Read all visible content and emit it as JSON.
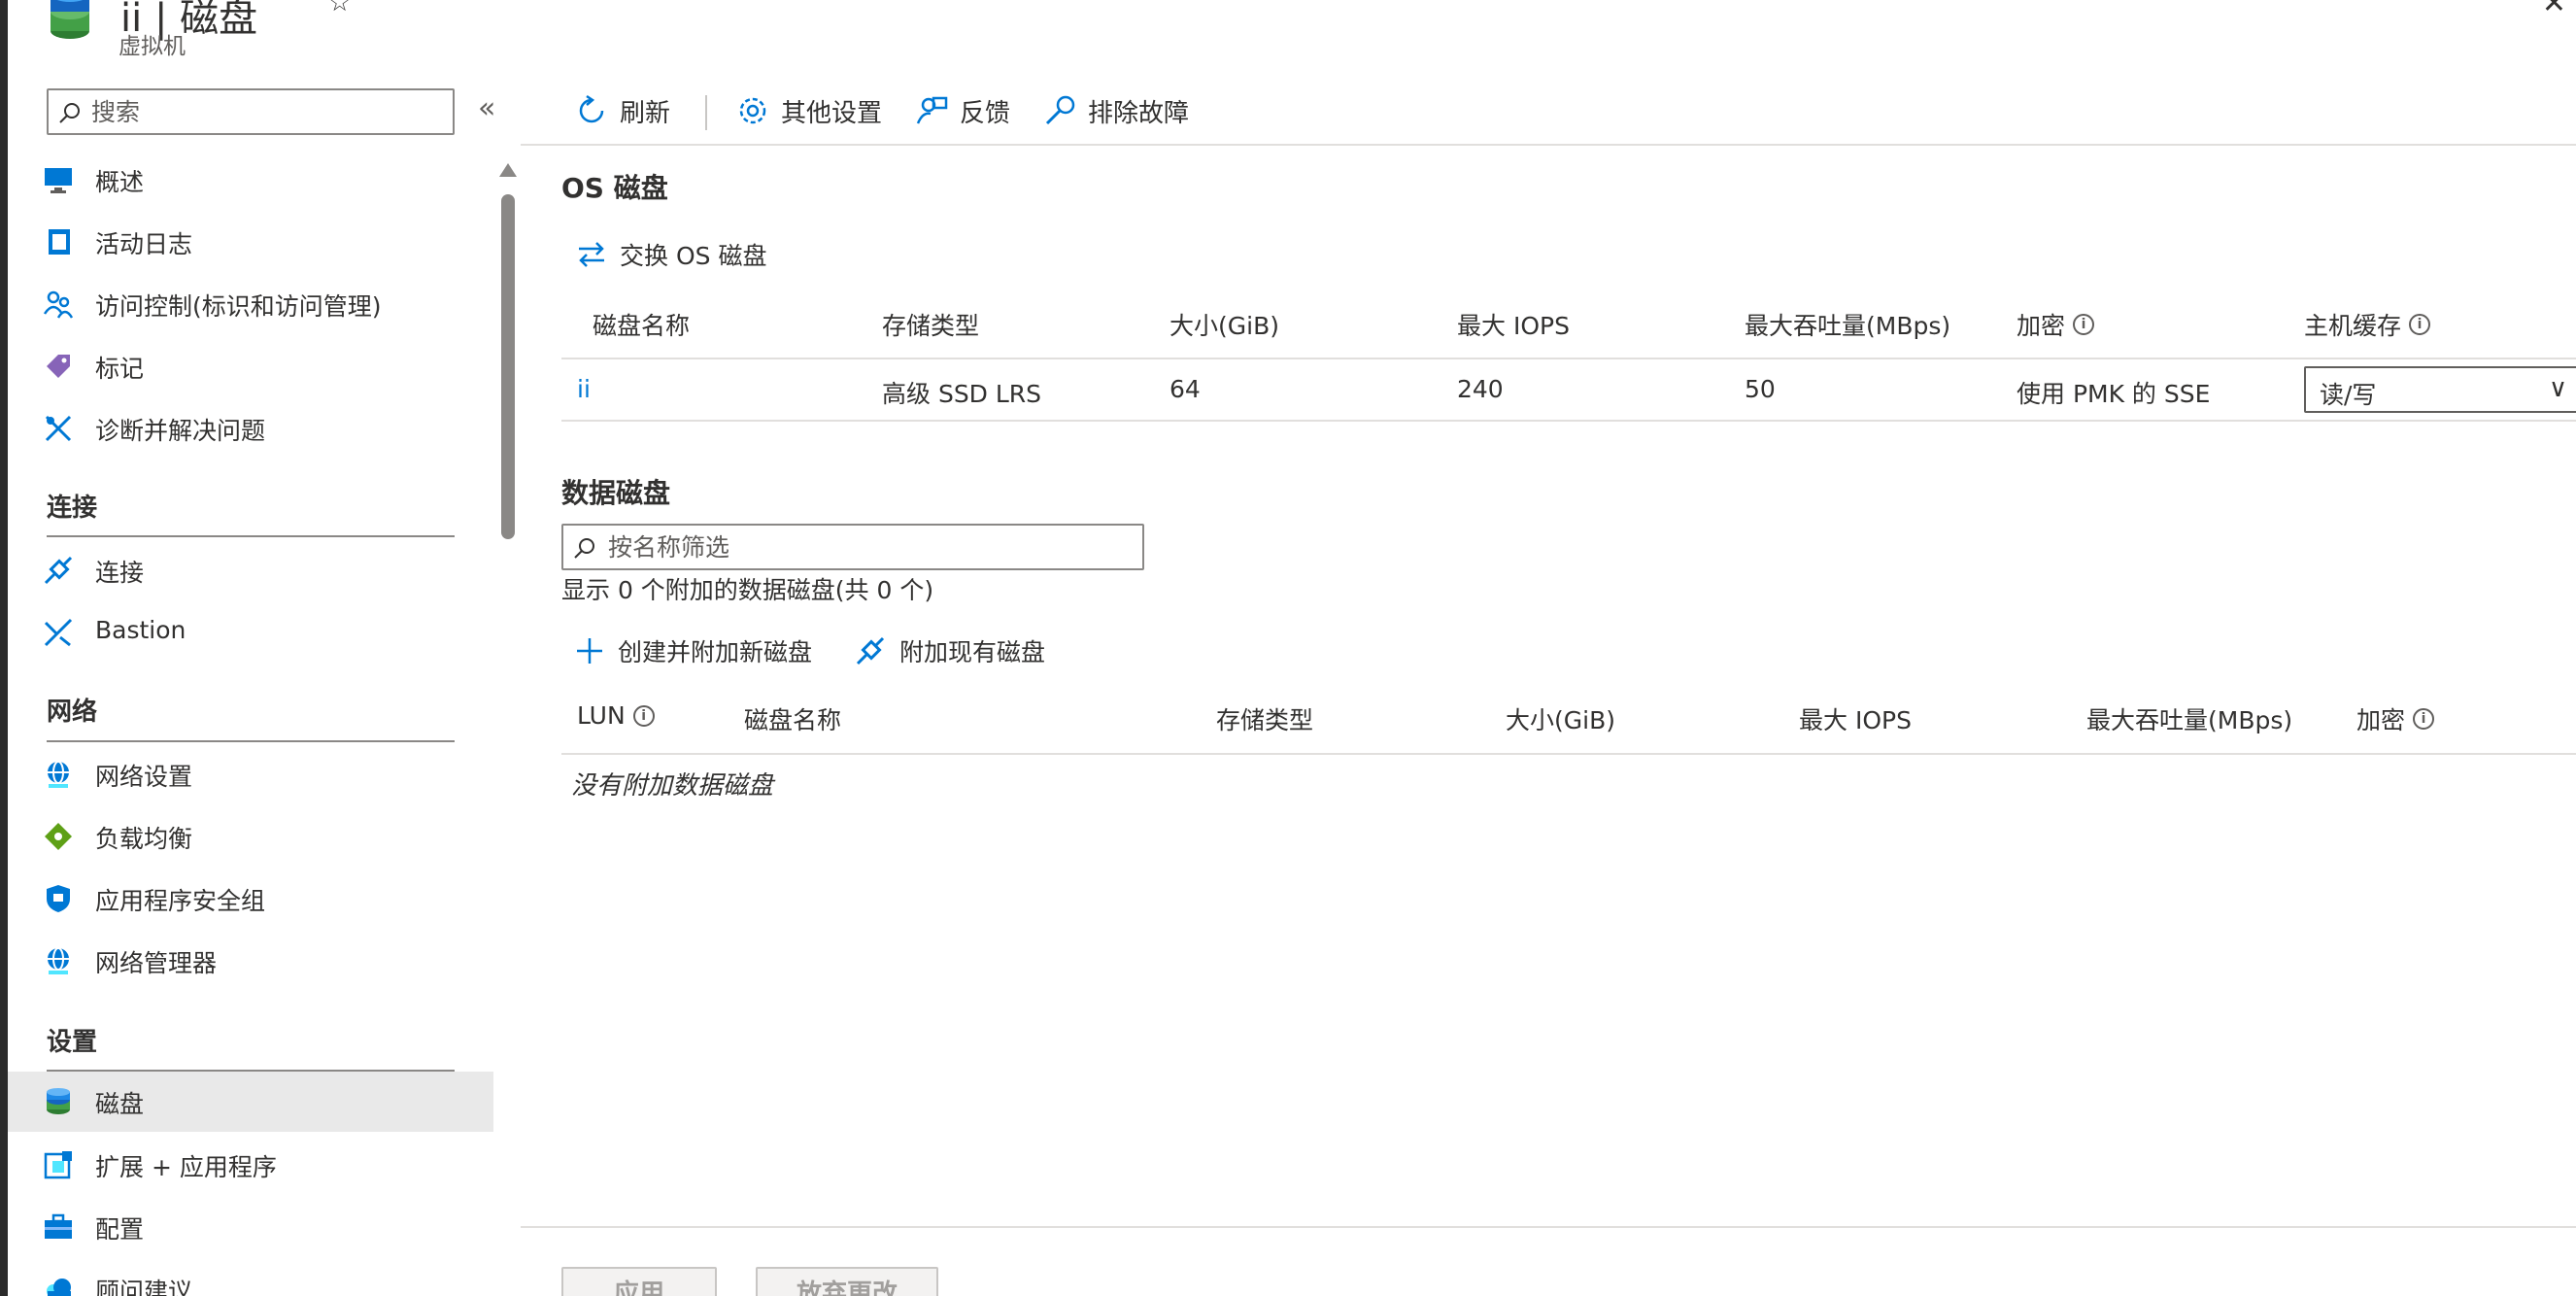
{
  "header": {
    "title": "ii | 磁盘",
    "subtitle": "虚拟机",
    "favorite_icon": "star-icon",
    "close_icon": "close-icon"
  },
  "sidebar": {
    "search_placeholder": "搜索",
    "collapse_glyph": "«",
    "groups": [
      {
        "heading": "",
        "items": [
          {
            "label": "概述",
            "icon": "monitor-icon"
          },
          {
            "label": "活动日志",
            "icon": "log-icon"
          },
          {
            "label": "访问控制(标识和访问管理)",
            "icon": "people-icon"
          },
          {
            "label": "标记",
            "icon": "tag-icon"
          },
          {
            "label": "诊断并解决问题",
            "icon": "wrench-icon"
          }
        ]
      },
      {
        "heading": "连接",
        "items": [
          {
            "label": "连接",
            "icon": "plug-icon"
          },
          {
            "label": "Bastion",
            "icon": "bastion-icon"
          }
        ]
      },
      {
        "heading": "网络",
        "items": [
          {
            "label": "网络设置",
            "icon": "globe-icon"
          },
          {
            "label": "负载均衡",
            "icon": "diamond-icon"
          },
          {
            "label": "应用程序安全组",
            "icon": "shield-icon"
          },
          {
            "label": "网络管理器",
            "icon": "network-manager-icon"
          }
        ]
      },
      {
        "heading": "设置",
        "items": [
          {
            "label": "磁盘",
            "icon": "disk-icon",
            "selected": true
          },
          {
            "label": "扩展 + 应用程序",
            "icon": "extension-icon"
          },
          {
            "label": "配置",
            "icon": "toolbox-icon"
          },
          {
            "label": "顾问建议",
            "icon": "cloud-icon"
          }
        ]
      }
    ]
  },
  "toolbar": {
    "refresh": "刷新",
    "other_settings": "其他设置",
    "feedback": "反馈",
    "troubleshoot": "排除故障"
  },
  "os_disk": {
    "heading": "OS 磁盘",
    "swap_action": "交换 OS 磁盘",
    "columns": [
      "磁盘名称",
      "存储类型",
      "大小(GiB)",
      "最大 IOPS",
      "最大吞吐量(MBps)",
      "加密",
      "主机缓存"
    ],
    "row": {
      "name": "ii",
      "storage_type": "高级 SSD LRS",
      "size": "64",
      "max_iops": "240",
      "max_throughput": "50",
      "encryption": "使用 PMK 的 SSE",
      "host_cache": "读/写"
    }
  },
  "data_disks": {
    "heading": "数据磁盘",
    "filter_placeholder": "按名称筛选",
    "count_text": "显示 0 个附加的数据磁盘(共 0 个)",
    "create_action": "创建并附加新磁盘",
    "attach_action": "附加现有磁盘",
    "columns": [
      "LUN",
      "磁盘名称",
      "存储类型",
      "大小(GiB)",
      "最大 IOPS",
      "最大吞吐量(MBps)",
      "加密"
    ],
    "empty_text": "没有附加数据磁盘"
  },
  "footer": {
    "apply": "应用",
    "discard": "放弃更改"
  },
  "colors": {
    "accent": "#0078d4",
    "selected_bg": "#e9e9e9"
  }
}
